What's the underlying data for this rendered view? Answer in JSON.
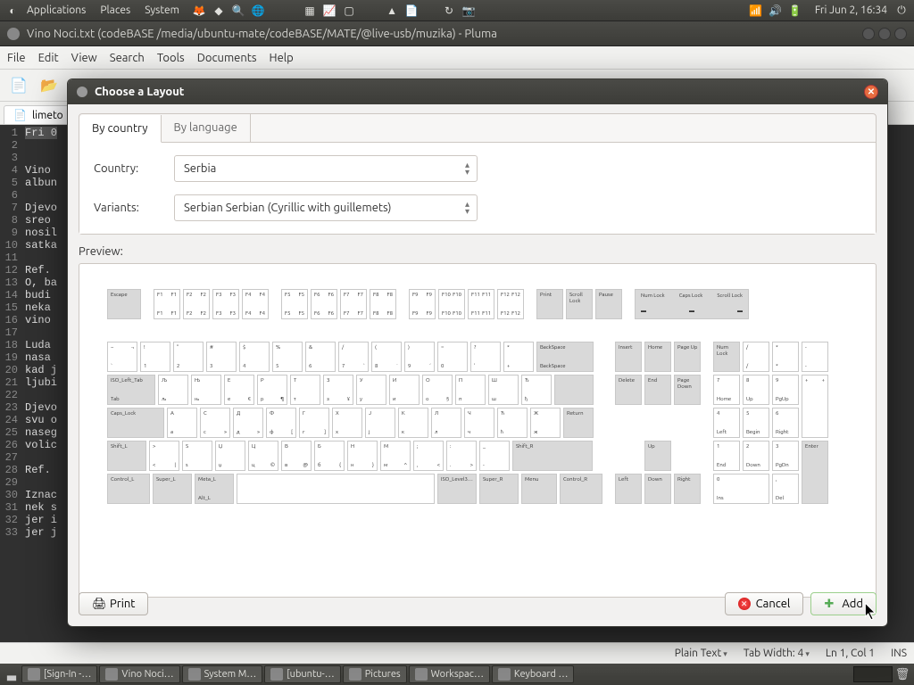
{
  "toppanel": {
    "menus": [
      "Applications",
      "Places",
      "System"
    ],
    "clock": "Fri Jun  2, 16:34"
  },
  "window": {
    "title": "Vino Noci.txt (codeBASE /media/ubuntu-mate/codeBASE/MATE/@live-usb/muzika) - Pluma"
  },
  "menubar": [
    "File",
    "Edit",
    "View",
    "Search",
    "Tools",
    "Documents",
    "Help"
  ],
  "tab": {
    "label": "limeto"
  },
  "editor_lines": [
    "Fri 0",
    "",
    "",
    "Vino ",
    "albun",
    "",
    "Djevo",
    "sreo ",
    "nosil",
    "satka",
    "",
    "Ref. ",
    "O, ba",
    "budi ",
    "neka ",
    "vino ",
    "",
    "Luda ",
    "nasa ",
    "kad j",
    "ljubi",
    "",
    "Djevo",
    "svu o",
    "naseg",
    "volic",
    "",
    "Ref.",
    "",
    "Iznac",
    "nek s",
    "jer i",
    "jer j"
  ],
  "statusbar": {
    "lang": "Plain Text",
    "tabwidth": "Tab Width: 4",
    "pos": "Ln 1, Col 1",
    "ins": "INS"
  },
  "taskbar": [
    "[Sign-In -…",
    "Vino Noci…",
    "System M…",
    "[ubuntu-…",
    "Pictures",
    "Workspac…",
    "Keyboard …"
  ],
  "dialog": {
    "title": "Choose a Layout",
    "tabs": {
      "active": "By country",
      "inactive": "By language"
    },
    "country_label": "Country:",
    "country_value": "Serbia",
    "variants_label": "Variants:",
    "variants_value": "Serbian Serbian (Cyrillic with guillemets)",
    "preview_label": "Preview:",
    "buttons": {
      "print": "Print",
      "cancel": "Cancel",
      "add": "Add"
    }
  },
  "keyboard": {
    "fn_groups": [
      [
        "F1",
        "F2",
        "F3",
        "F4"
      ],
      [
        "F5",
        "F6",
        "F7",
        "F8"
      ],
      [
        "F9",
        "F10",
        "F11",
        "F12"
      ]
    ],
    "nav_top": [
      "Print",
      "Scroll Lock",
      "Pause"
    ],
    "lock_top": [
      "Num Lock",
      "Caps Lock",
      "Scroll Lock"
    ],
    "escape": "Escape",
    "row1_special": {
      "backspace": "BackSpace"
    },
    "tab": "ISO_Left_Tab Tab",
    "caps": "Caps_Lock",
    "return": "Return",
    "shift_l": "Shift_L",
    "shift_r": "Shift_R",
    "ctrl_l": "Control_L",
    "super_l": "Super_L",
    "meta_alt": "Meta_L Alt_L",
    "iso3": "ISO_Level3…",
    "super_r": "Super_R",
    "menu": "Menu",
    "ctrl_r": "Control_R",
    "nav_mid": [
      [
        "Insert",
        "Home",
        "Page Up"
      ],
      [
        "Delete",
        "End",
        "Page Down"
      ]
    ],
    "arrows": {
      "up": "Up",
      "left": "Left",
      "down": "Down",
      "right": "Right"
    },
    "numpad": {
      "r0": [
        "Num Lock",
        "/",
        "*",
        "-"
      ],
      "r1": [
        [
          "7",
          "Home"
        ],
        [
          "8",
          "Up"
        ],
        [
          "9",
          "PgUp"
        ],
        [
          "+",
          "+"
        ]
      ],
      "r2": [
        [
          "4",
          "Left"
        ],
        [
          "5",
          "Begin"
        ],
        [
          "6",
          "Right"
        ]
      ],
      "r3": [
        [
          "1",
          "End"
        ],
        [
          "2",
          "Down"
        ],
        [
          "3",
          "PgDn"
        ],
        [
          "Enter",
          ""
        ]
      ],
      "r4": [
        [
          "0",
          "Ins"
        ],
        [
          ",",
          "Del"
        ]
      ]
    }
  }
}
